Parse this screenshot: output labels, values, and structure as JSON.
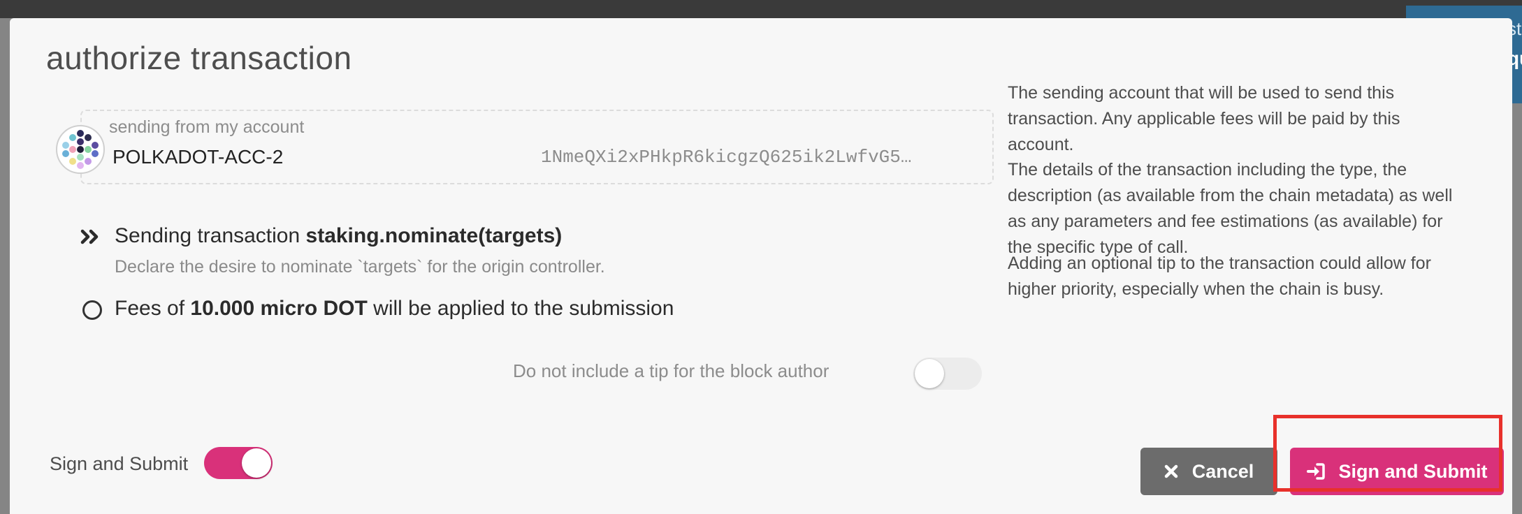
{
  "modal": {
    "title": "authorize transaction"
  },
  "account": {
    "label": "sending from my account",
    "name": "POLKADOT-ACC-2",
    "address": "1NmeQXi2xPHkpR6kicgzQ625ik2LwfvG5…",
    "avatar_icon": "identicon-icon"
  },
  "help": {
    "account": "The sending account that will be used to send this transaction. Any applicable fees will be paid by this account.",
    "details": "The details of the transaction including the type, the description (as available from the chain metadata) as well as any parameters and fee estimations (as available) for the specific type of call.",
    "tip": "Adding an optional tip to the transaction could allow for higher priority, especially when the chain is busy."
  },
  "transaction": {
    "prefix": "Sending transaction ",
    "call": "staking.nominate(targets)",
    "description": "Declare the desire to nominate `targets` for the origin controller.",
    "icon": "double-chevron-right-icon"
  },
  "fees": {
    "prefix": "Fees of ",
    "amount": "10.000 micro DOT",
    "suffix": " will be applied to the submission",
    "icon": "circle-icon"
  },
  "tip": {
    "label": "Do not include a tip for the block author",
    "enabled": false
  },
  "sign_toggle": {
    "label": "Sign and Submit",
    "enabled": true
  },
  "buttons": {
    "cancel": "Cancel",
    "cancel_icon": "close-icon",
    "submit": "Sign and Submit",
    "submit_icon": "sign-in-icon"
  },
  "notification": {
    "line1": "st",
    "line2": "qu",
    "icon": "shuffle-icon"
  },
  "colors": {
    "accent": "#d9317a",
    "cancel": "#6c6c6c",
    "highlight": "#e8312b",
    "notification": "#2e6a93"
  }
}
